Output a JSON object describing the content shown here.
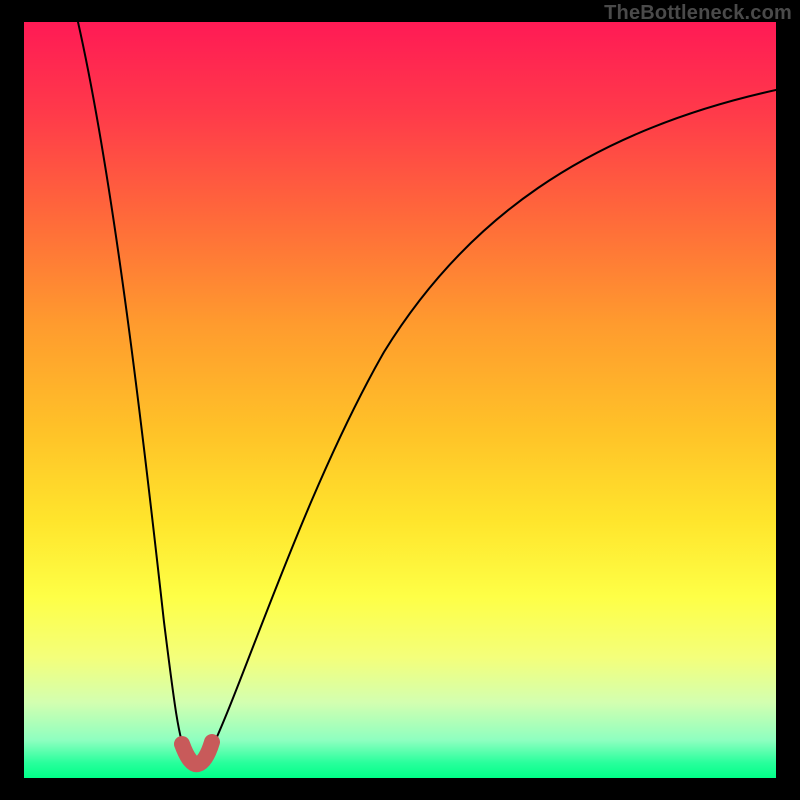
{
  "watermark": "TheBottleneck.com",
  "chart_data": {
    "type": "line",
    "title": "",
    "xlabel": "",
    "ylabel": "",
    "xlim": [
      0,
      100
    ],
    "ylim": [
      0,
      100
    ],
    "series": [
      {
        "name": "bottleneck-curve",
        "x": [
          0,
          5,
          10,
          14,
          17,
          19,
          20,
          21,
          23,
          26,
          30,
          36,
          44,
          54,
          66,
          80,
          100
        ],
        "y": [
          100,
          80,
          55,
          30,
          12,
          3,
          0,
          3,
          12,
          28,
          44,
          58,
          70,
          79,
          85,
          89,
          91
        ]
      }
    ],
    "marker": {
      "name": "optimal-range",
      "x": [
        19,
        20,
        21
      ],
      "y": [
        3,
        0,
        3
      ]
    },
    "legend": false,
    "grid": false
  },
  "colors": {
    "curve_stroke": "#000000",
    "marker_stroke": "#c85a5a",
    "gradient_top": "#ff1a55",
    "gradient_bottom": "#00ff88",
    "frame_bg": "#000000"
  }
}
